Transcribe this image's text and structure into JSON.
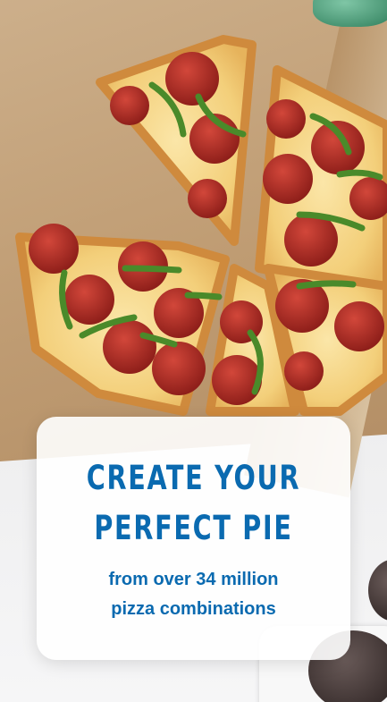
{
  "promo": {
    "headline_line1": "CREATE YOUR",
    "headline_line2": "PERFECT PIE",
    "subline_line1": "from over 34 million",
    "subline_line2": "pizza combinations"
  },
  "colors": {
    "accent": "#0a6ab0",
    "card_background": "#ffffff"
  }
}
